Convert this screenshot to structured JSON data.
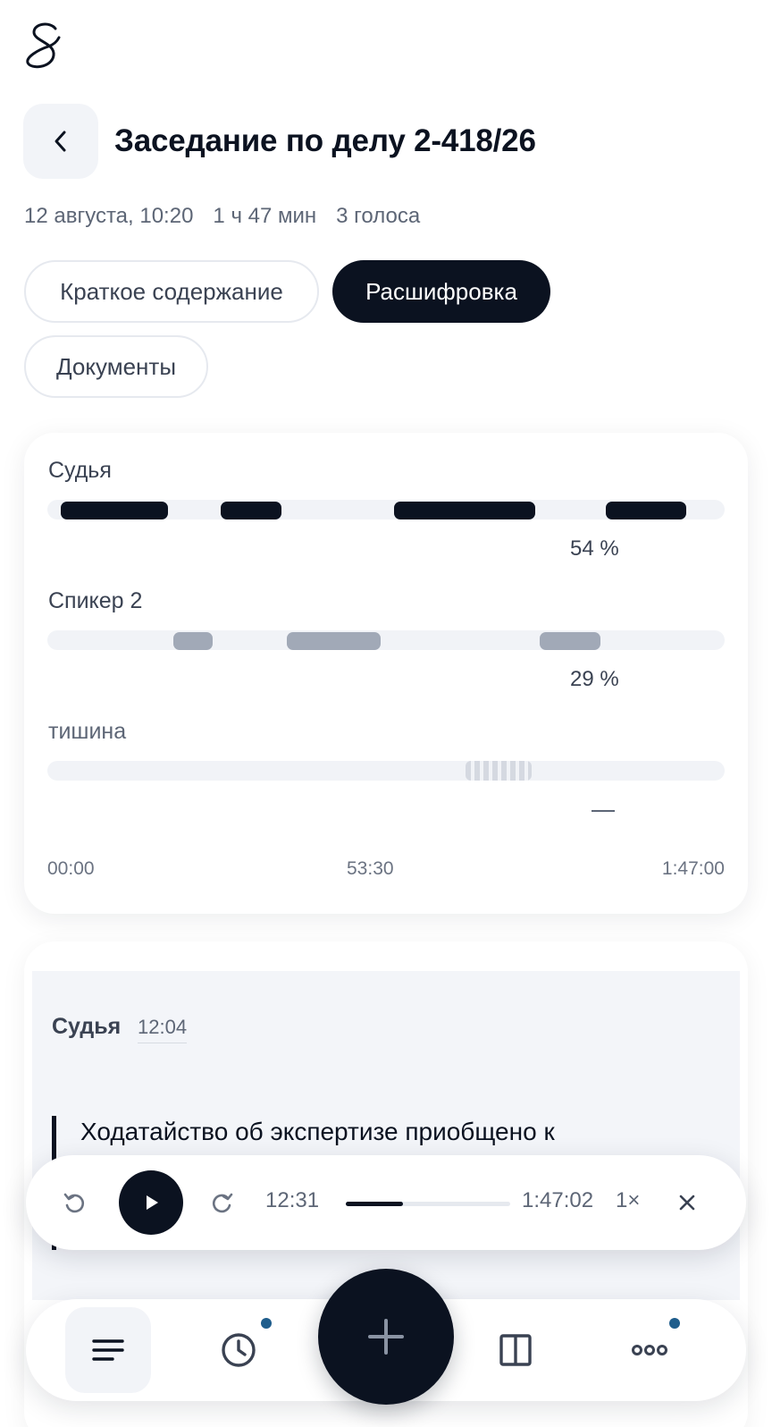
{
  "header": {
    "title": "Заседание по делу 2-418/26"
  },
  "meta": {
    "date": "12 августа, 10:20",
    "duration": "1 ч 47 мин",
    "voices": "3 голоса"
  },
  "tabs": [
    {
      "label": "Краткое содержание",
      "active": false
    },
    {
      "label": "Расшифровка",
      "active": true
    },
    {
      "label": "Документы",
      "active": false
    }
  ],
  "speaker_timeline": {
    "speakers": [
      {
        "name": "Судья",
        "share": "54 %"
      },
      {
        "name": "Спикер 2",
        "share": "29 %"
      },
      {
        "name": "тишина",
        "share": "—"
      }
    ],
    "axis": [
      "00:00",
      "53:30",
      "1:47:00"
    ]
  },
  "transcript": {
    "speaker": "Судья",
    "time": "12:04",
    "text": "Ходатайство об экспертизе приобщено к"
  },
  "player": {
    "current_time": "12:31",
    "total_time": "1:47:02",
    "speed": "1×",
    "progress": 0.35
  },
  "colors": {
    "primary": "#0b1220",
    "accent_dot": "#1f5d8c",
    "muted_segment": "#a1a9b7",
    "surface": "#f2f4f8"
  },
  "icons": {
    "logo": "s-signature-logo",
    "back": "chevron-left-icon",
    "replay": "rewind-icon",
    "play": "play-icon",
    "forward": "forward-icon",
    "close": "close-icon",
    "list": "list-icon",
    "history": "clock-icon",
    "add": "plus-icon",
    "split": "split-view-icon",
    "more": "more-icon"
  }
}
